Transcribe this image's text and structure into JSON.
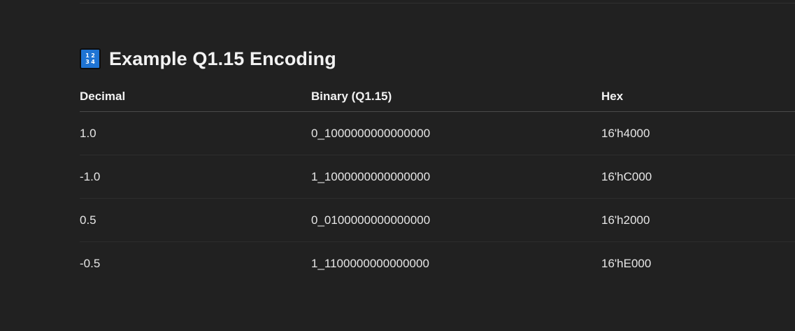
{
  "section": {
    "icon": "input-numbers-icon",
    "icon_glyphs": [
      "1",
      "2",
      "3",
      "4"
    ],
    "title": "Example Q1.15 Encoding"
  },
  "table": {
    "headers": [
      "Decimal",
      "Binary (Q1.15)",
      "Hex"
    ],
    "rows": [
      [
        "1.0",
        "0_1000000000000000",
        "16'h4000"
      ],
      [
        "-1.0",
        "1_1000000000000000",
        "16'hC000"
      ],
      [
        "0.5",
        "0_0100000000000000",
        "16'h2000"
      ],
      [
        "-0.5",
        "1_1100000000000000",
        "16'hE000"
      ]
    ]
  },
  "colors": {
    "background": "#212121",
    "text": "#ececec",
    "icon_blue": "#1f74d4"
  }
}
